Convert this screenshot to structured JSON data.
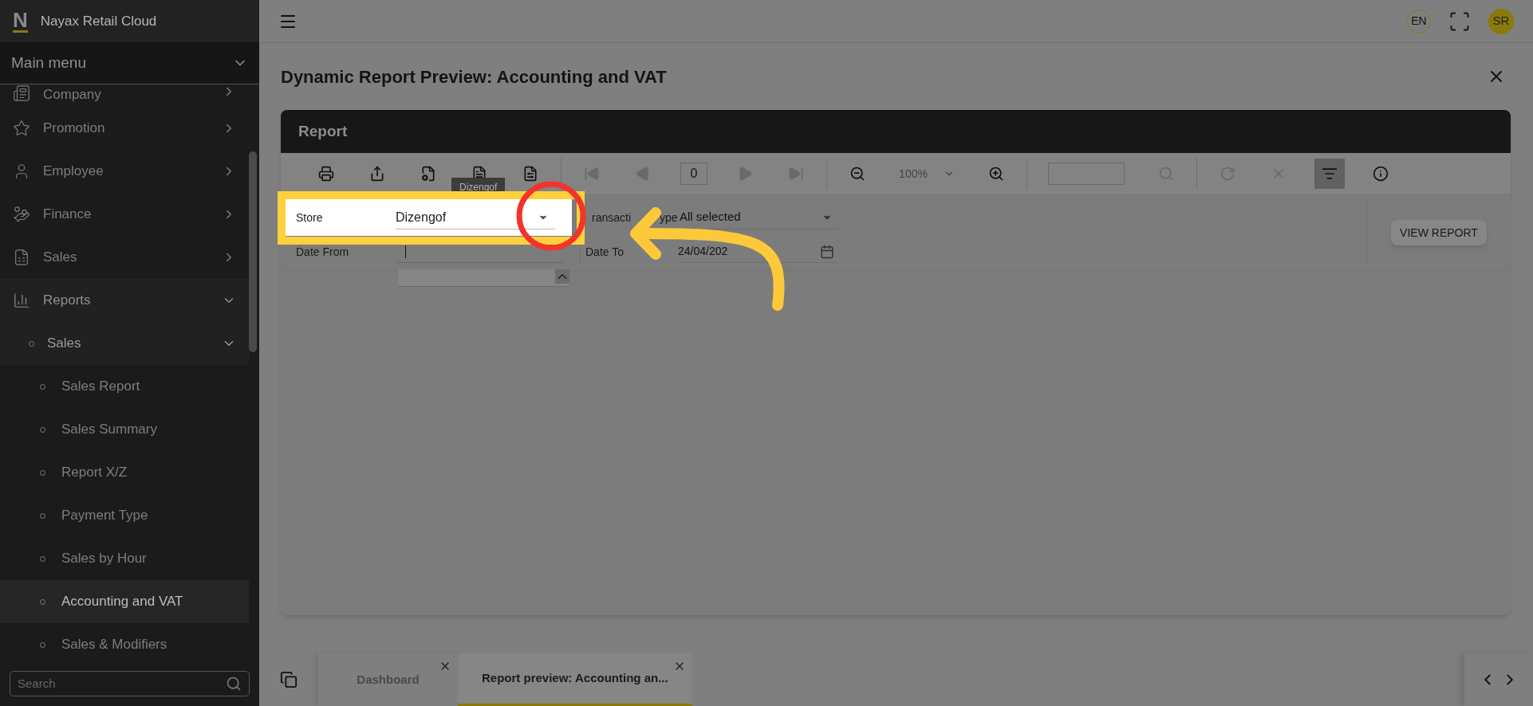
{
  "app": {
    "logo_letter": "N",
    "name": "Nayax Retail Cloud"
  },
  "sidebar": {
    "menu_title": "Main menu",
    "items": [
      {
        "label": "Company",
        "expanded": false,
        "selected": false
      },
      {
        "label": "Promotion",
        "expanded": false,
        "selected": false
      },
      {
        "label": "Employee",
        "expanded": false,
        "selected": false
      },
      {
        "label": "Finance",
        "expanded": false,
        "selected": false
      },
      {
        "label": "Sales",
        "expanded": false,
        "selected": false
      },
      {
        "label": "Reports",
        "expanded": true,
        "selected": false,
        "children": [
          {
            "label": "Sales",
            "expanded": true,
            "selected": false,
            "children": [
              {
                "label": "Sales Report",
                "selected": false
              },
              {
                "label": "Sales Summary",
                "selected": false
              },
              {
                "label": "Report X/Z",
                "selected": false
              },
              {
                "label": "Payment Type",
                "selected": false
              },
              {
                "label": "Sales by Hour",
                "selected": false
              },
              {
                "label": "Accounting and VAT",
                "selected": true
              },
              {
                "label": "Sales & Modifiers",
                "selected": false
              }
            ]
          }
        ]
      }
    ],
    "search": {
      "placeholder": "Search"
    }
  },
  "topbar": {
    "language": "EN",
    "avatar_initials": "SR"
  },
  "page": {
    "title": "Dynamic Report Preview: Accounting and VAT"
  },
  "panel": {
    "title": "Report",
    "toolbar": [
      {
        "kind": "print",
        "disabled": false
      },
      {
        "kind": "export",
        "disabled": false
      },
      {
        "kind": "file-settings",
        "disabled": false
      },
      {
        "kind": "document",
        "disabled": false
      },
      {
        "kind": "page-settings",
        "disabled": false
      },
      {
        "kind": "divider"
      },
      {
        "kind": "first",
        "disabled": true
      },
      {
        "kind": "prev",
        "disabled": true
      },
      {
        "kind": "page-field",
        "value": "0"
      },
      {
        "kind": "next",
        "disabled": true
      },
      {
        "kind": "last",
        "disabled": true
      },
      {
        "kind": "divider"
      },
      {
        "kind": "zoom-out",
        "disabled": false
      },
      {
        "kind": "zoom-select",
        "value": "100%"
      },
      {
        "kind": "zoom-in",
        "disabled": false
      },
      {
        "kind": "divider"
      },
      {
        "kind": "search-field"
      },
      {
        "kind": "search",
        "disabled": true
      },
      {
        "kind": "divider"
      },
      {
        "kind": "refresh",
        "disabled": true
      },
      {
        "kind": "cancel",
        "disabled": true
      },
      {
        "kind": "filter",
        "disabled": false,
        "selected": true
      },
      {
        "kind": "info",
        "disabled": false
      }
    ],
    "tooltip": "Dizengof",
    "filters": {
      "store": {
        "label": "Store",
        "value": "Dizengof"
      },
      "date_from": {
        "label": "Date From"
      },
      "transaction_type": {
        "label_parts": [
          "ransacti",
          "ype"
        ],
        "value": "All selected"
      },
      "date_to": {
        "label": "Date To",
        "value": "24/04/202"
      }
    },
    "view_button": "VIEW REPORT"
  },
  "tabs": [
    {
      "label": "Dashboard",
      "selected": false
    },
    {
      "label": "Report preview: Accounting an...",
      "selected": true
    }
  ]
}
